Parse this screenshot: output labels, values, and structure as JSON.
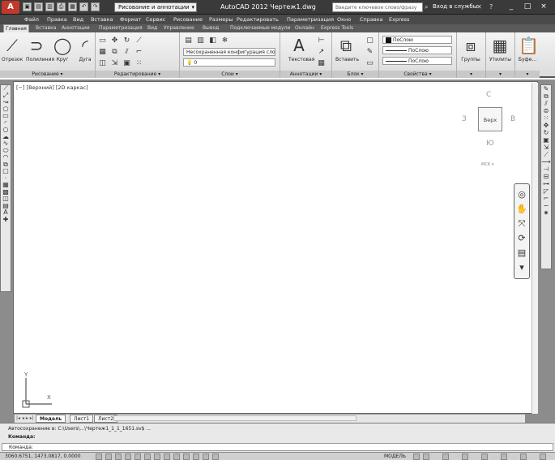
{
  "title_bar": {
    "app_button": "A",
    "quick_access": [
      "▣",
      "▤",
      "▥",
      "⎙",
      "▦",
      "↶",
      "↷"
    ],
    "workspace": "Рисование и аннотации",
    "app_title": "AutoCAD 2012   Чертеж1.dwg",
    "search_placeholder": "Введите ключевое слово/фразу",
    "signin": "Вход в службы",
    "window_controls": [
      "_",
      "□",
      "×"
    ]
  },
  "menu": [
    "Файл",
    "Правка",
    "Вид",
    "Вставка",
    "Формат",
    "Сервис",
    "Рисование",
    "Размеры",
    "Редактировать",
    "Параметризация",
    "Окно",
    "Справка",
    "Express"
  ],
  "ribbon_tabs": [
    "Главная",
    "Вставка",
    "Аннотации",
    "Параметризация",
    "Вид",
    "Управление",
    "Вывод",
    "Подключаемые модули",
    "Онлайн",
    "Express Tools"
  ],
  "ribbon": {
    "draw_tools": [
      "Отрезок",
      "Полилиния",
      "Круг",
      "Дуга"
    ],
    "draw_panel": "Рисование ▾",
    "modify_panel": "Редактирование ▾",
    "layer_state": "Несохраненная конфигурация слоев",
    "layer_current": "0",
    "layers_panel": "Слои ▾",
    "text_tool": "Текстовая",
    "annotation_panel": "Аннотации ▾",
    "insert_tool": "Вставить",
    "block_panel": "Блок ▾",
    "color": "ПоСлою",
    "linetype": "ПоСлою",
    "lineweight": "ПоСлою",
    "properties_panel": "Свойства ▾",
    "groups_tool": "Группы",
    "utilities_tool": "Утилиты",
    "clipboard_tool": "Буфе..."
  },
  "viewport": {
    "label": "[−] [Верхний] [2D каркас]",
    "viewcube_face": "Верх",
    "viewcube_dirs": [
      "С",
      "З",
      "В",
      "Ю"
    ],
    "wcs": "МСК ▾"
  },
  "ucs": {
    "y": "Y",
    "x": "X"
  },
  "layout_tabs": {
    "nav": "|◂ ◂ ▸ ▸|",
    "tabs": [
      "Модель",
      "Лист1",
      "Лист2"
    ]
  },
  "command": {
    "history": "Автосохранение в: C:\\Users\\...\\Чертеж1_1_1_1651.sv$ ...",
    "line2": "Команда:",
    "line3": "Команда:"
  },
  "status_bar": {
    "coords": "3060.6751, 1473.0817, 0.0000",
    "model": "МОДЕЛЬ"
  }
}
